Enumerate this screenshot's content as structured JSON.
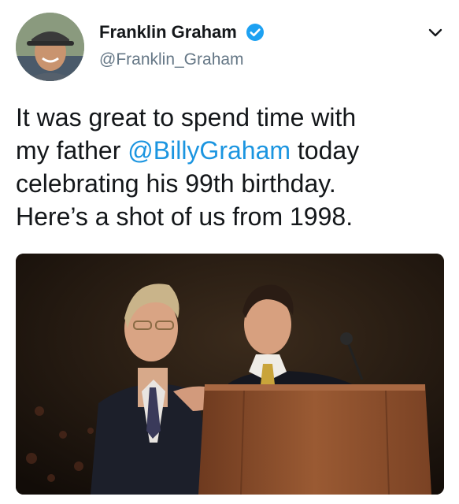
{
  "author": {
    "display_name": "Franklin Graham",
    "handle": "@Franklin_Graham",
    "verified": true,
    "avatar_icon": "profile-photo"
  },
  "tweet": {
    "lines": [
      {
        "pre": "It was great to spend time with",
        "mention": "",
        "post": ""
      },
      {
        "pre": "my father ",
        "mention": "@BillyGraham",
        "post": " today"
      },
      {
        "pre": "celebrating his 99th birthday.",
        "mention": "",
        "post": ""
      },
      {
        "pre": "Here’s a shot of us from 1998.",
        "mention": "",
        "post": ""
      }
    ]
  },
  "menu": {
    "icon": "chevron-down-icon"
  },
  "media": {
    "type": "photo"
  },
  "colors": {
    "link": "#1b95e0",
    "verified": "#1da1f2",
    "text": "#14171a",
    "secondary": "#657786"
  }
}
